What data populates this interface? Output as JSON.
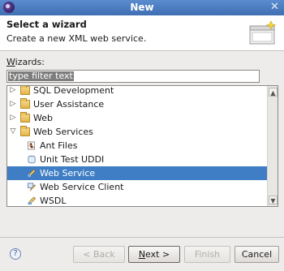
{
  "window": {
    "title": "New"
  },
  "header": {
    "title": "Select a wizard",
    "description": "Create a new XML web service."
  },
  "wizards_label": "Wizards:",
  "filter": {
    "selected_text": "type filter text"
  },
  "tree": {
    "items": [
      {
        "label": "SQL Development",
        "expanded": false,
        "icon": "folder-icon"
      },
      {
        "label": "User Assistance",
        "expanded": false,
        "icon": "folder-icon"
      },
      {
        "label": "Web",
        "expanded": false,
        "icon": "folder-icon"
      },
      {
        "label": "Web Services",
        "expanded": true,
        "icon": "folder-open-icon"
      },
      {
        "label": "Ant Files",
        "icon": "ant-file-icon"
      },
      {
        "label": "Unit Test UDDI",
        "icon": "uddi-icon"
      },
      {
        "label": "Web Service",
        "icon": "web-service-icon",
        "selected": true
      },
      {
        "label": "Web Service Client",
        "icon": "web-service-client-icon"
      },
      {
        "label": "WSDL",
        "icon": "wsdl-icon"
      }
    ]
  },
  "buttons": {
    "back": "< Back",
    "next": "Next >",
    "finish": "Finish",
    "cancel": "Cancel"
  },
  "colors": {
    "selection": "#3f7ec4",
    "titlebar": "#4a7cc0"
  }
}
